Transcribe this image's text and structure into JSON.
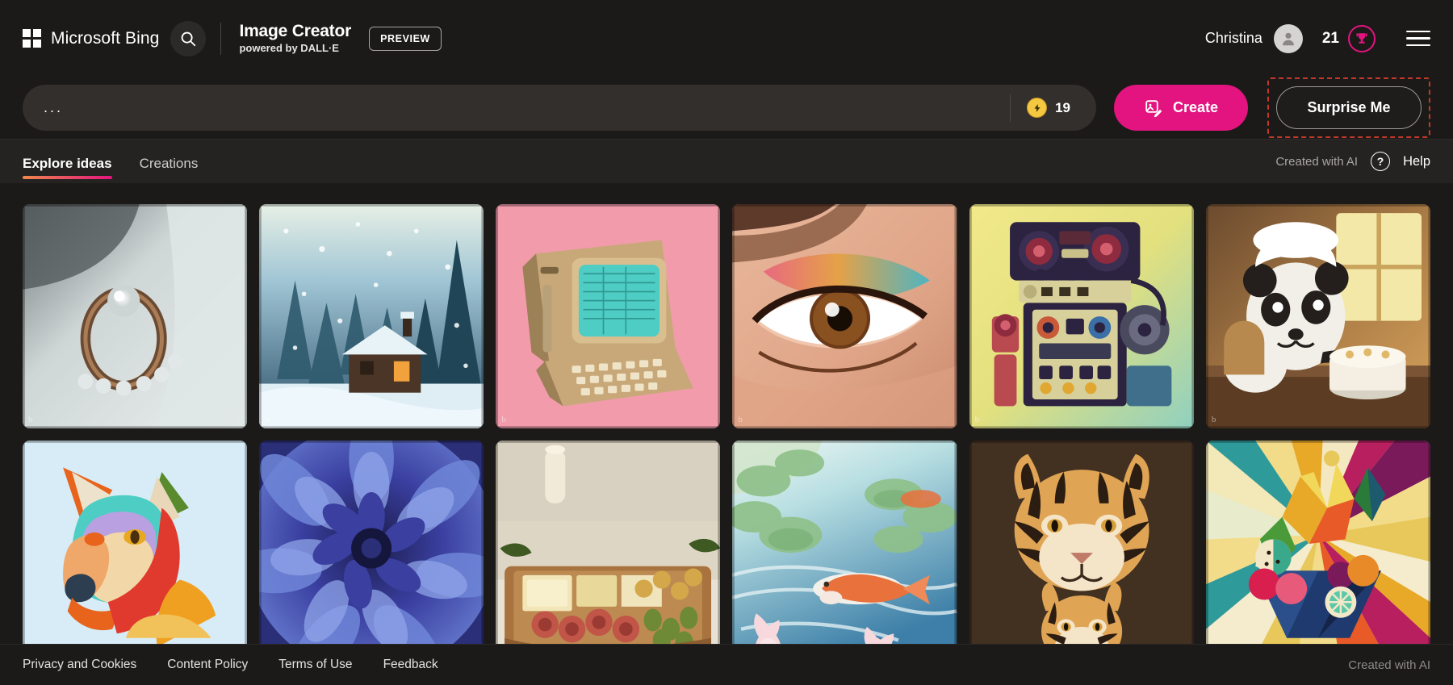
{
  "header": {
    "brand_name": "Microsoft Bing",
    "search_icon": "search-icon",
    "app_title": "Image Creator",
    "app_subtitle": "powered by DALL·E",
    "preview_badge": "PREVIEW",
    "user_name": "Christina",
    "avatar_icon": "person-icon",
    "rewards_points": "21",
    "rewards_icon": "trophy-icon",
    "menu_icon": "hamburger-menu-icon"
  },
  "prompt": {
    "value": "",
    "placeholder": "...",
    "boost_icon": "lightning-bolt-coin-icon",
    "boost_count": "19",
    "create_label": "Create",
    "create_icon": "image-edit-icon",
    "surprise_label": "Surprise Me",
    "accent_pink": "#e3147f",
    "highlight_color": "#c0392b"
  },
  "tabs": {
    "items": [
      {
        "label": "Explore ideas",
        "active": true
      },
      {
        "label": "Creations",
        "active": false
      }
    ],
    "created_with_ai": "Created with AI",
    "help_icon": "question-circle-icon",
    "help_label": "Help"
  },
  "grid": {
    "watermark": "b",
    "tiles": [
      {
        "name": "pearl-ring-on-silk",
        "alt": "Ornate pearl ring resting on white silk fabric"
      },
      {
        "name": "snowy-cabin-forest",
        "alt": "Log cabin in a snowy pine forest at night"
      },
      {
        "name": "retro-computer-pink",
        "alt": "Vintage computer terminal on pink background"
      },
      {
        "name": "eye-makeup-closeup",
        "alt": "Close-up of an eye with colorful eyeshadow"
      },
      {
        "name": "boombox-robot",
        "alt": "Retro robot made of boombox stereo parts"
      },
      {
        "name": "panda-chef-cake",
        "alt": "Panda chef decorating a cake in a sunlit kitchen"
      },
      {
        "name": "paper-fox-portrait",
        "alt": "Colorful paper-craft fox portrait"
      },
      {
        "name": "blue-dahlia-flower",
        "alt": "Macro photo of a deep blue dahlia flower"
      },
      {
        "name": "charcuterie-board",
        "alt": "Charcuterie board with cheese, meats and olives"
      },
      {
        "name": "koi-pond-watercolor",
        "alt": "Watercolor koi fish swimming among lily pads"
      },
      {
        "name": "tiger-family-portrait",
        "alt": "Stylized tiger with cub portrait"
      },
      {
        "name": "geometric-fruit-bowl",
        "alt": "Geometric low-poly bowl of fruit"
      }
    ]
  },
  "footer": {
    "links": [
      "Privacy and Cookies",
      "Content Policy",
      "Terms of Use",
      "Feedback"
    ],
    "created_with_ai": "Created with AI"
  }
}
